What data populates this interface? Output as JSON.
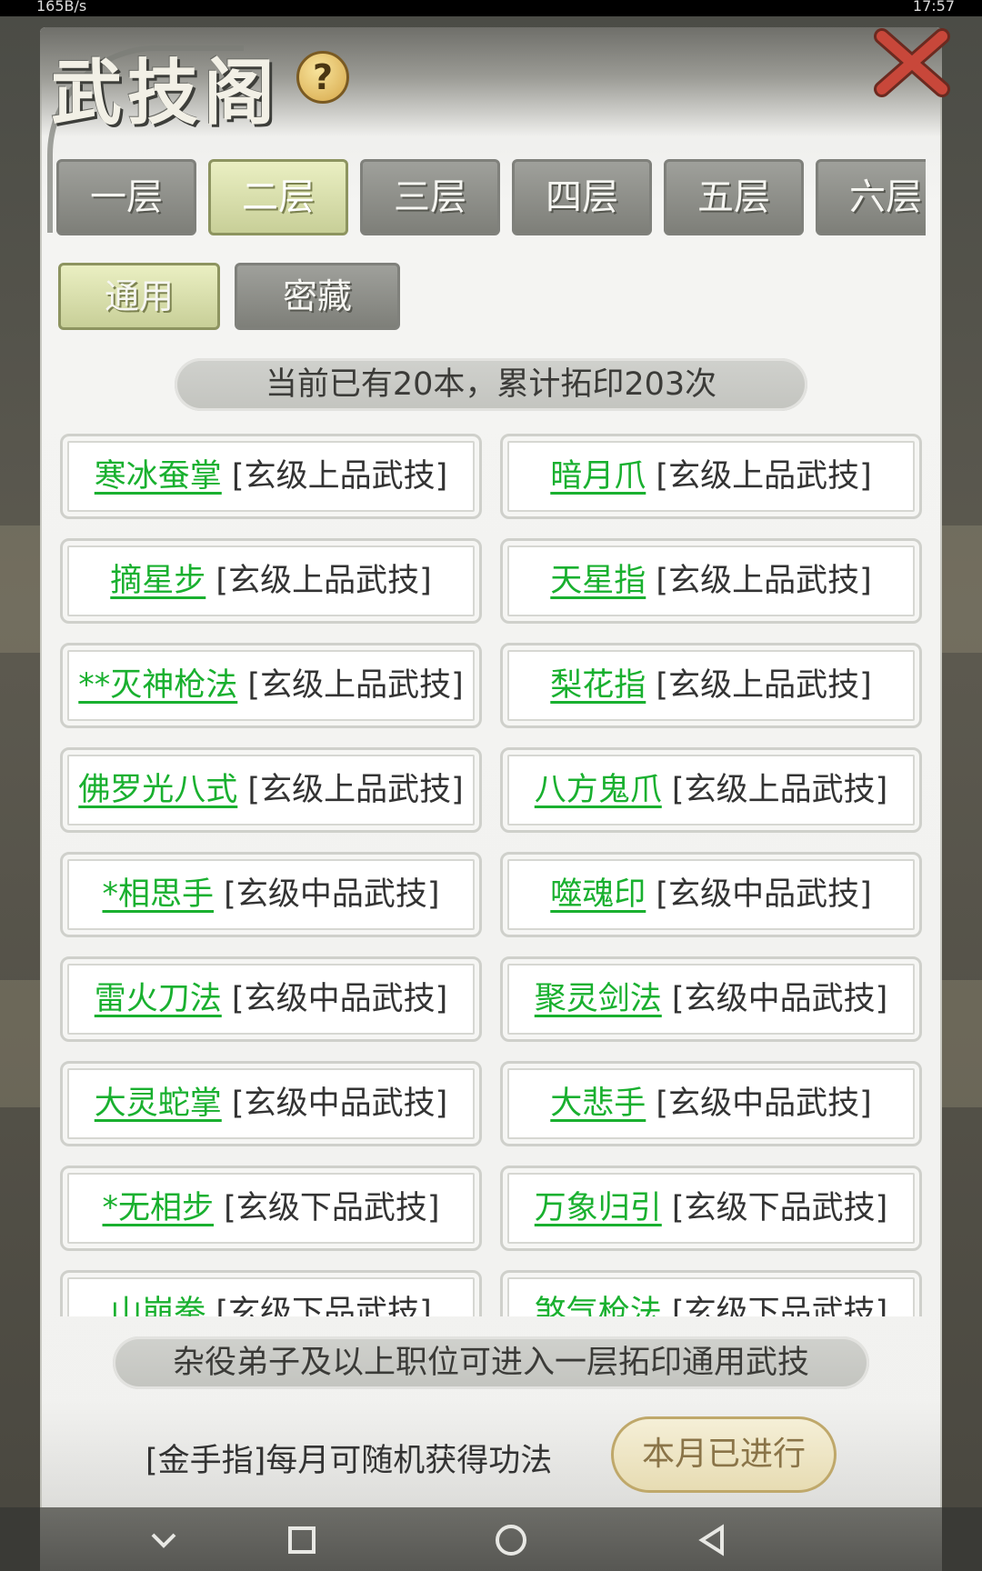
{
  "status_bar": {
    "left": "165B/s",
    "right": "17:57"
  },
  "title": "武技阁",
  "help_label": "?",
  "floor_tabs": [
    {
      "label": "一层"
    },
    {
      "label": "二层"
    },
    {
      "label": "三层"
    },
    {
      "label": "四层"
    },
    {
      "label": "五层"
    },
    {
      "label": "六层"
    }
  ],
  "active_floor": "二层",
  "category_tabs": [
    {
      "label": "通用"
    },
    {
      "label": "密藏"
    }
  ],
  "active_category": "通用",
  "summary": "当前已有20本，累计拓印203次",
  "skills": [
    {
      "name": "寒冰蚕掌",
      "grade": "[玄级上品武技]"
    },
    {
      "name": "暗月爪",
      "grade": "[玄级上品武技]"
    },
    {
      "name": "摘星步",
      "grade": "[玄级上品武技]"
    },
    {
      "name": "天星指",
      "grade": "[玄级上品武技]"
    },
    {
      "name": "**灭神枪法",
      "grade": "[玄级上品武技]"
    },
    {
      "name": "梨花指",
      "grade": "[玄级上品武技]"
    },
    {
      "name": "佛罗光八式",
      "grade": "[玄级上品武技]"
    },
    {
      "name": "八方鬼爪",
      "grade": "[玄级上品武技]"
    },
    {
      "name": "*相思手",
      "grade": "[玄级中品武技]"
    },
    {
      "name": "噬魂印",
      "grade": "[玄级中品武技]"
    },
    {
      "name": "雷火刀法",
      "grade": "[玄级中品武技]"
    },
    {
      "name": "聚灵剑法",
      "grade": "[玄级中品武技]"
    },
    {
      "name": "大灵蛇掌",
      "grade": "[玄级中品武技]"
    },
    {
      "name": "大悲手",
      "grade": "[玄级中品武技]"
    },
    {
      "name": "*无相步",
      "grade": "[玄级下品武技]"
    },
    {
      "name": "万象归引",
      "grade": "[玄级下品武技]"
    },
    {
      "name": "山崩拳",
      "grade": "[玄级下品武技]"
    },
    {
      "name": "煞气枪法",
      "grade": "[玄级下品武技]"
    }
  ],
  "notice": "杂役弟子及以上职位可进入一层拓印通用武技",
  "footer": {
    "text": "[金手指]每月可随机获得功法",
    "button_label": "本月已进行"
  },
  "colors": {
    "skill_name": "#19b02f",
    "active_tab": "#dfe5b3",
    "inactive_tab": "#8e8f89"
  }
}
